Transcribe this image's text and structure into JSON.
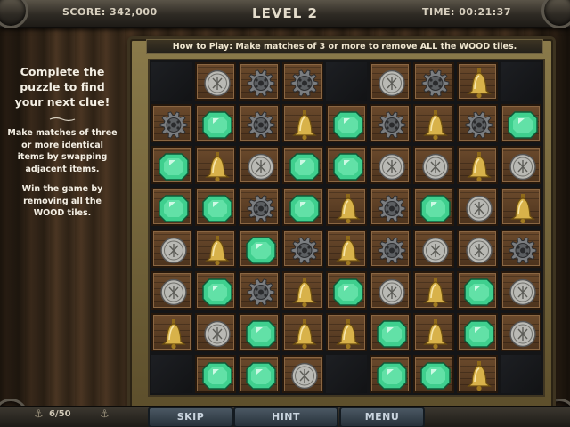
{
  "hud": {
    "score": "SCORE: 342,000",
    "level": "LEVEL 2",
    "time": "TIME: 00:21:37"
  },
  "left_panel": {
    "headline": "Complete the puzzle to find your next clue!",
    "instructions": "Make matches of three or more identical items by swapping adjacent items.",
    "win_text": "Win the game by removing all the WOOD tiles."
  },
  "howto": "How to Play: Make matches of 3 or more to remove ALL the WOOD tiles.",
  "board": {
    "legend": {
      "e": "emerald",
      "c": "coin",
      "g": "gear",
      "b": "bell",
      "-": "empty"
    },
    "rows": [
      [
        "-",
        "c",
        "g",
        "g",
        "-",
        "c",
        "g",
        "b",
        "-"
      ],
      [
        "g",
        "e",
        "g",
        "b",
        "e",
        "g",
        "b",
        "g",
        "e"
      ],
      [
        "e",
        "b",
        "c",
        "e",
        "e",
        "c",
        "c",
        "b",
        "c"
      ],
      [
        "e",
        "e",
        "g",
        "e",
        "b",
        "g",
        "e",
        "c",
        "b"
      ],
      [
        "c",
        "b",
        "e",
        "g",
        "b",
        "g",
        "c",
        "c",
        "g"
      ],
      [
        "c",
        "e",
        "g",
        "b",
        "e",
        "c",
        "b",
        "e",
        "c"
      ],
      [
        "b",
        "c",
        "e",
        "b",
        "b",
        "e",
        "b",
        "e",
        "c"
      ],
      [
        "-",
        "e",
        "e",
        "c",
        "-",
        "e",
        "e",
        "b",
        "-"
      ]
    ]
  },
  "bottom": {
    "counter": "6/50",
    "skip_label": "SKIP",
    "hint_label": "HINT",
    "menu_label": "MENU"
  },
  "colors": {
    "emerald": "#3fcf8e",
    "coin": "#b9b9b4",
    "gear": "#7a7d80",
    "bell": "#d8b24a",
    "wood": "#5b3e24"
  }
}
